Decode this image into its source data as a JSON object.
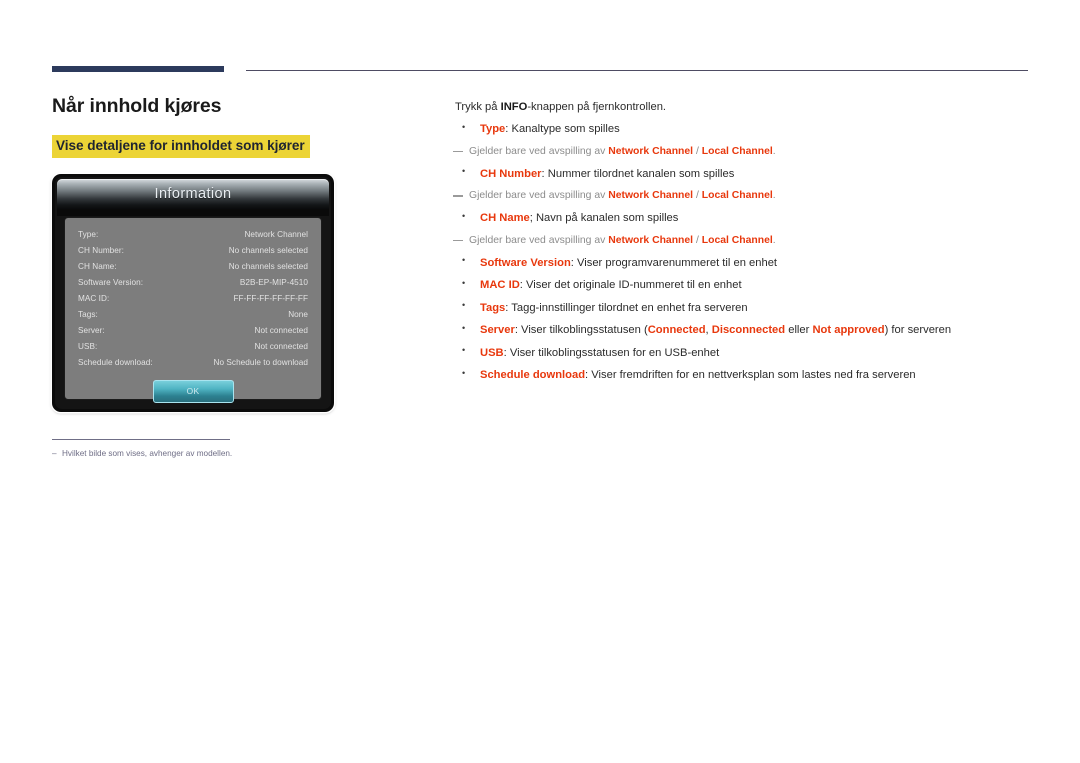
{
  "header": {
    "rule_thick_color": "#2c3a5c",
    "rule_thin_color": "#4e4c63"
  },
  "left": {
    "page_title": "Når innhold kjøres",
    "sub_title": "Vise detaljene for innholdet som kjører",
    "highlight_color": "#ecd436",
    "footnote_dash": "–",
    "footnote": "Hvilket bilde som vises, avhenger av modellen."
  },
  "dialog": {
    "title": "Information",
    "ok_label": "OK",
    "rows": [
      {
        "label": "Type:",
        "value": "Network Channel"
      },
      {
        "label": "CH Number:",
        "value": "No channels selected"
      },
      {
        "label": "CH Name:",
        "value": "No channels selected"
      },
      {
        "label": "Software Version:",
        "value": "B2B-EP-MIP-4510"
      },
      {
        "label": "MAC ID:",
        "value": "FF-FF-FF-FF-FF-FF"
      },
      {
        "label": "Tags:",
        "value": "None"
      },
      {
        "label": "Server:",
        "value": "Not connected"
      },
      {
        "label": "USB:",
        "value": "Not connected"
      },
      {
        "label": "Schedule download:",
        "value": "No Schedule to download"
      }
    ]
  },
  "right": {
    "accent_color": "#e8380d",
    "intro_before": "Trykk på ",
    "intro_keyword": "INFO",
    "intro_after": "-knappen på fjernkontrollen.",
    "note_prefix": "Gjelder bare ved avspilling av ",
    "note_term_a": "Network Channel",
    "note_separator": " / ",
    "note_term_b": "Local Channel",
    "note_suffix": ".",
    "items": [
      {
        "term": "Type",
        "rest": ": Kanaltype som spilles",
        "has_note": true
      },
      {
        "term": "CH Number",
        "rest": ": Nummer tilordnet kanalen som spilles",
        "has_note": true
      },
      {
        "term": "CH Name",
        "rest": "; Navn på kanalen som spilles",
        "has_note": true
      },
      {
        "term": "Software Version",
        "rest": ": Viser programvarenummeret til en enhet",
        "has_note": false
      },
      {
        "term": "MAC ID",
        "rest": ": Viser det originale ID-nummeret til en enhet",
        "has_note": false
      },
      {
        "term": "Tags",
        "rest": ": Tagg-innstillinger tilordnet en enhet fra serveren",
        "has_note": false
      },
      {
        "term": "USB",
        "rest": ": Viser tilkoblingsstatusen for en USB-enhet",
        "has_note": false
      },
      {
        "term": "Schedule download",
        "rest": ": Viser fremdriften for en nettverksplan som lastes ned fra serveren",
        "has_note": false
      }
    ],
    "server_item": {
      "term": "Server",
      "part1": ": Viser tilkoblingsstatusen (",
      "status_connected": "Connected",
      "comma": ", ",
      "status_disconnected": "Disconnected",
      "eller": " eller ",
      "status_not_approved": "Not approved",
      "part2": ") for serveren"
    }
  }
}
